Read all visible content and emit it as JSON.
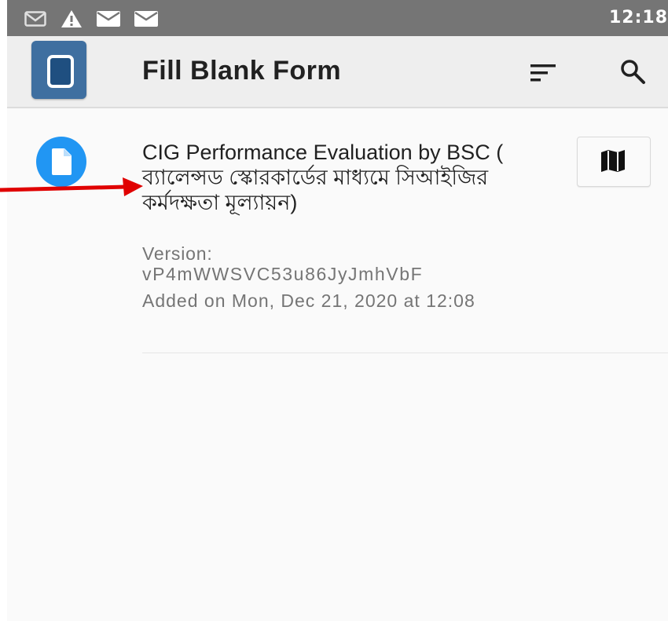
{
  "status_bar": {
    "time": "12:18",
    "icons": [
      "gmail-icon",
      "warning-icon",
      "mail-icon",
      "mail-icon"
    ]
  },
  "toolbar": {
    "title": "Fill Blank Form",
    "sort_icon": "sort-icon",
    "search_icon": "search-icon",
    "logo_icon": "odk-collect-logo"
  },
  "forms": [
    {
      "title": "CIG Performance Evaluation by BSC ( ব্যালেন্সড স্কোরকার্ডের মাধ্যমে সিআইজির কর্মদক্ষতা মূল্যায়ন)",
      "version_label": "Version:",
      "version_value": "vP4mWWSVC53u86JyJmhVbF",
      "added": "Added on Mon, Dec 21, 2020 at 12:08",
      "icon": "form-document-icon",
      "action_icon": "map-icon"
    }
  ],
  "colors": {
    "status_bar": "#757575",
    "toolbar": "#eeeeee",
    "logo": "#3f6fa0",
    "form_icon": "#2196f3",
    "annotation_arrow": "#e00000"
  }
}
